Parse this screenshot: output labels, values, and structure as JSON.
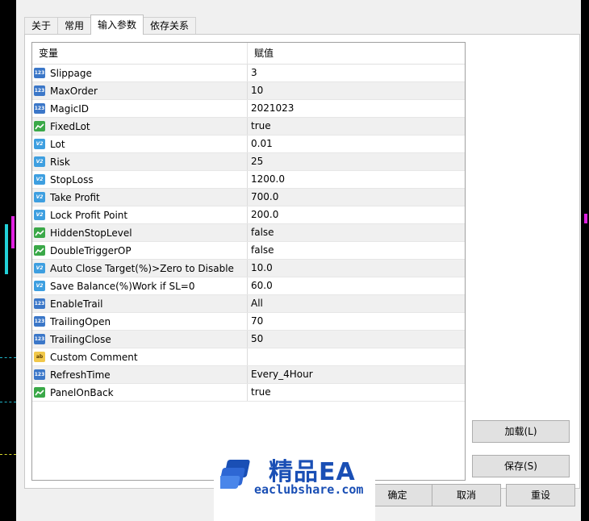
{
  "tabs": [
    {
      "label": "关于"
    },
    {
      "label": "常用"
    },
    {
      "label": "输入参数"
    },
    {
      "label": "依存关系"
    }
  ],
  "grid": {
    "header": {
      "variable": "变量",
      "value": "赋值"
    },
    "rows": [
      {
        "type": "int",
        "name": "Slippage",
        "value": "3"
      },
      {
        "type": "int",
        "name": "MaxOrder",
        "value": "10"
      },
      {
        "type": "int",
        "name": "MagicID",
        "value": "2021023"
      },
      {
        "type": "bool",
        "name": "FixedLot",
        "value": "true"
      },
      {
        "type": "double",
        "name": "Lot",
        "value": "0.01"
      },
      {
        "type": "double",
        "name": "Risk",
        "value": "25"
      },
      {
        "type": "double",
        "name": "StopLoss",
        "value": "1200.0"
      },
      {
        "type": "double",
        "name": "Take Profit",
        "value": "700.0"
      },
      {
        "type": "double",
        "name": "Lock Profit Point",
        "value": "200.0"
      },
      {
        "type": "bool",
        "name": "HiddenStopLevel",
        "value": "false"
      },
      {
        "type": "bool",
        "name": "DoubleTriggerOP",
        "value": "false"
      },
      {
        "type": "double",
        "name": "Auto Close Target(%)>Zero to Disable",
        "value": "10.0"
      },
      {
        "type": "double",
        "name": "Save Balance(%)Work if SL=0",
        "value": "60.0"
      },
      {
        "type": "int",
        "name": "EnableTrail",
        "value": "All"
      },
      {
        "type": "int",
        "name": "TrailingOpen",
        "value": "70"
      },
      {
        "type": "int",
        "name": "TrailingClose",
        "value": "50"
      },
      {
        "type": "string",
        "name": "Custom Comment",
        "value": ""
      },
      {
        "type": "int",
        "name": "RefreshTime",
        "value": "Every_4Hour"
      },
      {
        "type": "bool",
        "name": "PanelOnBack",
        "value": "true"
      }
    ]
  },
  "buttons": {
    "load": "加载(L)",
    "save": "保存(S)",
    "ok": "确定",
    "cancel": "取消",
    "reset": "重设"
  },
  "watermark": {
    "brand": "精品EA",
    "url": "eaclubshare.com"
  },
  "icons": {
    "int": "123",
    "double": "V2",
    "bool": "bool-chart-icon",
    "string": "ab"
  },
  "colors": {
    "brand_blue": "#1a4fb5",
    "chart_cyan": "#22d0d8",
    "chart_magenta": "#e020e0"
  }
}
